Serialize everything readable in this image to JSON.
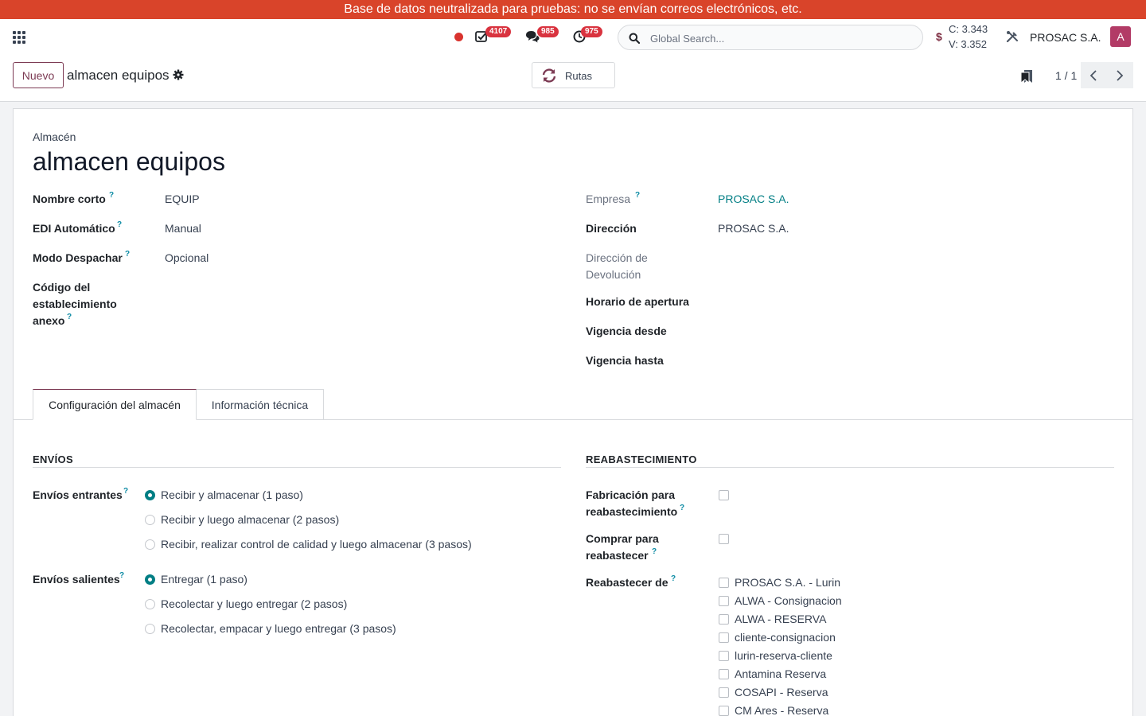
{
  "banner": {
    "text": "Base de datos neutralizada para pruebas: no se envían correos electrónicos, etc."
  },
  "navbar": {
    "activities_count": "4107",
    "messages_count": "985",
    "timer_count": "975",
    "search_placeholder": "Global Search...",
    "currency_symbol": "$",
    "rate_buy": "C: 3.343",
    "rate_sell": "V: 3.352",
    "company": "PROSAC S.A.",
    "avatar_letter": "A"
  },
  "control_panel": {
    "new_label": "Nuevo",
    "record_title": "almacen equipos",
    "rutas_label": "Rutas",
    "pager_value": "1 / 1"
  },
  "form": {
    "type_label": "Almacén",
    "title": "almacen equipos",
    "help_mark": "?",
    "left_fields": [
      {
        "label": "Nombre corto",
        "value": "EQUIP"
      },
      {
        "label": "EDI Automático",
        "value": "Manual"
      },
      {
        "label": "Modo Despachar",
        "value": "Opcional"
      },
      {
        "label_lines": [
          "Código del",
          "establecimiento",
          "anexo"
        ],
        "value": ""
      }
    ],
    "right_fields": [
      {
        "label": "Empresa",
        "value": "PROSAC S.A."
      },
      {
        "label": "Dirección",
        "value": "PROSAC S.A."
      },
      {
        "label_lines": [
          "Dirección de",
          "Devolución"
        ],
        "value": ""
      },
      {
        "label": "Horario de apertura",
        "value": ""
      },
      {
        "label": "Vigencia desde",
        "value": ""
      },
      {
        "label": "Vigencia hasta",
        "value": ""
      }
    ]
  },
  "tabs": [
    {
      "label": "Configuración del almacén",
      "active": true
    },
    {
      "label": "Información técnica",
      "active": false
    }
  ],
  "envios": {
    "title": "ENVÍOS",
    "entrantes": {
      "label": "Envíos entrantes",
      "options": [
        {
          "label": "Recibir y almacenar (1 paso)",
          "selected": true
        },
        {
          "label": "Recibir y luego almacenar (2 pasos)",
          "selected": false
        },
        {
          "label": "Recibir, realizar control de calidad y luego almacenar (3 pasos)",
          "selected": false
        }
      ]
    },
    "salientes": {
      "label": "Envíos salientes",
      "options": [
        {
          "label": "Entregar (1 paso)",
          "selected": true
        },
        {
          "label": "Recolectar y luego entregar (2 pasos)",
          "selected": false
        },
        {
          "label": "Recolectar, empacar y luego entregar (3 pasos)",
          "selected": false
        }
      ]
    }
  },
  "reabastecimiento": {
    "title": "REABASTECIMIENTO",
    "fabricacion_lines": [
      "Fabricación para",
      "reabastecimiento"
    ],
    "fabricacion_checked": false,
    "comprar_lines": [
      "Comprar para",
      "reabastecer"
    ],
    "comprar_checked": false,
    "reabastecer_label": "Reabastecer de",
    "warehouses": [
      {
        "label": "PROSAC S.A. - Lurin",
        "checked": false
      },
      {
        "label": "ALWA - Consignacion",
        "checked": false
      },
      {
        "label": "ALWA - RESERVA",
        "checked": false
      },
      {
        "label": "cliente-consignacion",
        "checked": false
      },
      {
        "label": "lurin-reserva-cliente",
        "checked": false
      },
      {
        "label": "Antamina Reserva",
        "checked": false
      },
      {
        "label": "COSAPI - Reserva",
        "checked": false
      },
      {
        "label": "CM Ares - Reserva",
        "checked": false
      }
    ]
  },
  "colors": {
    "primary": "#7c3a53",
    "link": "#017e84",
    "banner": "#d9442a",
    "badge": "#d9333f",
    "avatar": "#b23b66"
  }
}
